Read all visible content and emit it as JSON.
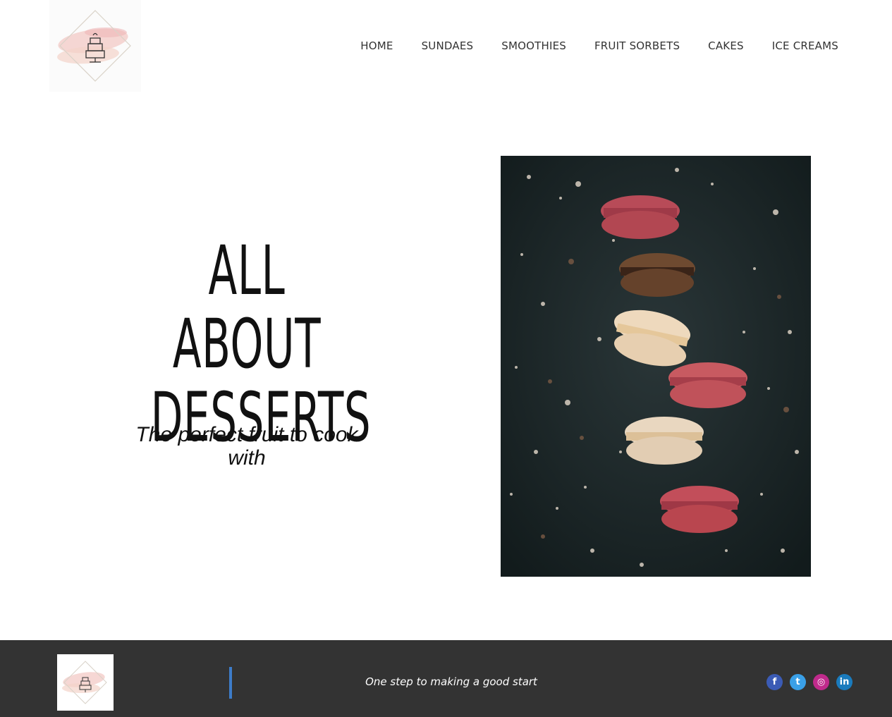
{
  "nav": {
    "items": [
      {
        "label": "HOME"
      },
      {
        "label": "SUNDAES"
      },
      {
        "label": "SMOOTHIES"
      },
      {
        "label": "FRUIT SORBETS"
      },
      {
        "label": "CAKES"
      },
      {
        "label": "ICE CREAMS"
      }
    ]
  },
  "hero": {
    "title_line1": "ALL ABOUT",
    "title_line2": "DESSERTS",
    "subtitle": "The perfect fruit to cook with",
    "image_icon": "macarons-photo"
  },
  "footer": {
    "tagline": "One step to making a good start",
    "accent_color": "#3d7cc9",
    "background_color": "#333333",
    "social": [
      {
        "icon": "facebook-icon",
        "glyph": "f"
      },
      {
        "icon": "twitter-icon",
        "glyph": "t"
      },
      {
        "icon": "instagram-icon",
        "glyph": "◎"
      },
      {
        "icon": "linkedin-icon",
        "glyph": "in"
      }
    ]
  }
}
